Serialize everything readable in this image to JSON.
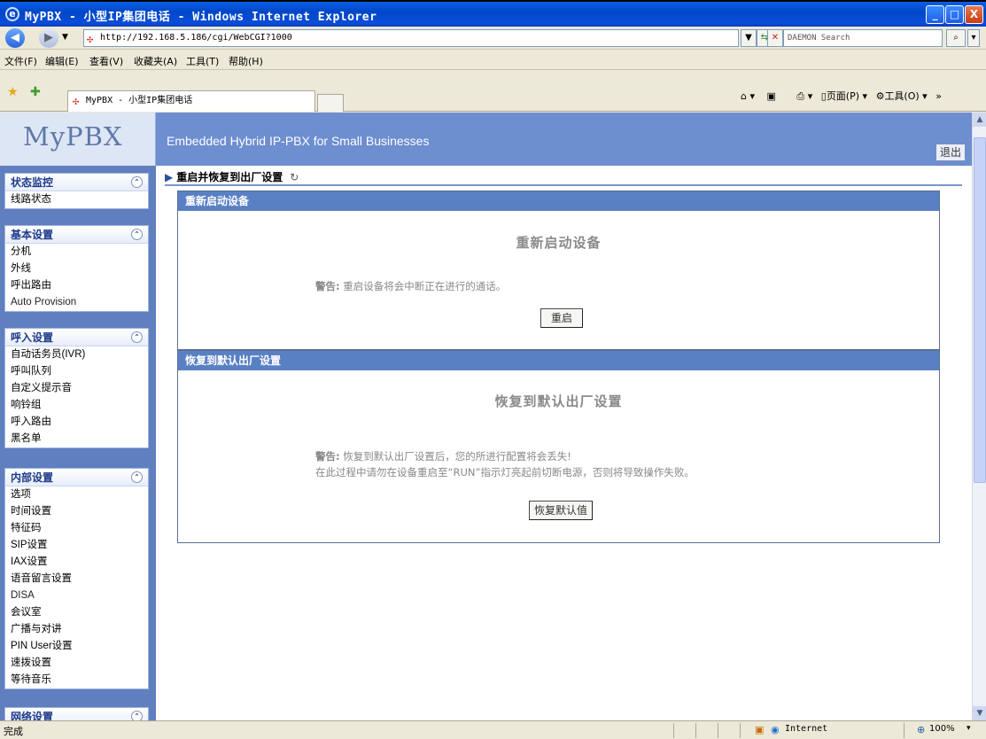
{
  "window": {
    "title": "MyPBX - 小型IP集团电话 - Windows Internet Explorer",
    "minimize": "_",
    "maximize": "□",
    "close": "X"
  },
  "address": {
    "url": "http://192.168.5.186/cgi/WebCGI?1000",
    "search_placeholder": "DAEMON Search"
  },
  "menu": [
    "文件(F)",
    "编辑(E)",
    "查看(V)",
    "收藏夹(A)",
    "工具(T)",
    "帮助(H)"
  ],
  "tab": {
    "label": "MyPBX - 小型IP集团电话"
  },
  "toolbar": {
    "page": "页面(P)",
    "tools": "工具(O)"
  },
  "banner": {
    "logo": "MyPBX",
    "tagline": "Embedded Hybrid IP-PBX for Small Businesses",
    "logout": "退出"
  },
  "sidebar": {
    "groups": [
      {
        "title": "状态监控",
        "items": [
          "线路状态"
        ]
      },
      {
        "title": "基本设置",
        "items": [
          "分机",
          "外线",
          "呼出路由",
          "Auto Provision"
        ]
      },
      {
        "title": "呼入设置",
        "items": [
          "自动话务员(IVR)",
          "呼叫队列",
          "自定义提示音",
          "响铃组",
          "呼入路由",
          "黑名单"
        ]
      },
      {
        "title": "内部设置",
        "items": [
          "选项",
          "时间设置",
          "特征码",
          "SIP设置",
          "IAX设置",
          "语音留言设置",
          "DISA",
          "会议室",
          "广播与对讲",
          "PIN User设置",
          "速拨设置",
          "等待音乐"
        ]
      },
      {
        "title": "网络设置",
        "items": []
      }
    ]
  },
  "main": {
    "breadcrumb": "重启并恢复到出厂设置",
    "reboot": {
      "header": "重新启动设备",
      "title": "重新启动设备",
      "warn_label": "警告:",
      "warn_text": "重启设备将会中断正在进行的通话。",
      "button": "重启"
    },
    "reset": {
      "header": "恢复到默认出厂设置",
      "title": "恢复到默认出厂设置",
      "warn_label": "警告:",
      "warn_text1": "恢复到默认出厂设置后，您的所进行配置将会丢失!",
      "warn_text2": "在此过程中请勿在设备重启至“RUN”指示灯亮起前切断电源，否则将导致操作失败。",
      "button": "恢复默认值"
    }
  },
  "status": {
    "text": "完成",
    "zone": "Internet",
    "zoom": "100%"
  }
}
